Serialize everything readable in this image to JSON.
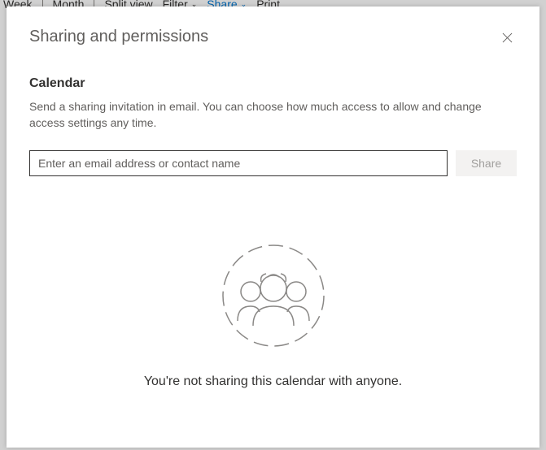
{
  "toolbar": {
    "week": "Week",
    "month": "Month",
    "split": "Split view",
    "filter": "Filter",
    "share": "Share",
    "print": "Print"
  },
  "dialog": {
    "title": "Sharing and permissions",
    "section": "Calendar",
    "description": "Send a sharing invitation in email. You can choose how much access to allow and change access settings any time.",
    "input_placeholder": "Enter an email address or contact name",
    "share_button": "Share",
    "empty_message": "You're not sharing this calendar with anyone."
  }
}
